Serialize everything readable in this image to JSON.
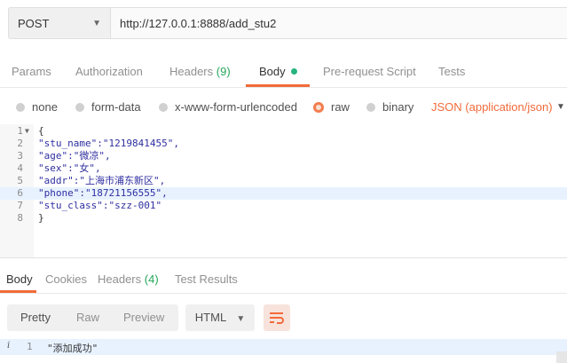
{
  "request": {
    "method": "POST",
    "url": "http://127.0.0.1:8888/add_stu2"
  },
  "request_tabs": {
    "params": "Params",
    "authorization": "Authorization",
    "headers": "Headers",
    "headers_count": "(9)",
    "body": "Body",
    "prerequest": "Pre-request Script",
    "tests": "Tests"
  },
  "body_types": {
    "none": "none",
    "form_data": "form-data",
    "urlencoded": "x-www-form-urlencoded",
    "raw": "raw",
    "binary": "binary",
    "selected": "raw",
    "content_type": "JSON (application/json)"
  },
  "editor": {
    "lines": [
      {
        "n": "1",
        "text": "{"
      },
      {
        "n": "2",
        "text": "\"stu_name\":\"1219841455\","
      },
      {
        "n": "3",
        "text": "\"age\":\"微凉\","
      },
      {
        "n": "4",
        "text": "\"sex\":\"女\","
      },
      {
        "n": "5",
        "text": "\"addr\":\"上海市浦东新区\","
      },
      {
        "n": "6",
        "text": "\"phone\":\"18721156555\","
      },
      {
        "n": "7",
        "text": "\"stu_class\":\"szz-001\""
      },
      {
        "n": "8",
        "text": "}"
      }
    ]
  },
  "response_tabs": {
    "body": "Body",
    "cookies": "Cookies",
    "headers": "Headers",
    "headers_count": "(4)",
    "test_results": "Test Results"
  },
  "response_toolbar": {
    "pretty": "Pretty",
    "raw": "Raw",
    "preview": "Preview",
    "format": "HTML"
  },
  "response_body": {
    "line_number": "1",
    "text": "\"添加成功\""
  },
  "colors": {
    "accent": "#f26b3a",
    "green": "#26b47f"
  }
}
